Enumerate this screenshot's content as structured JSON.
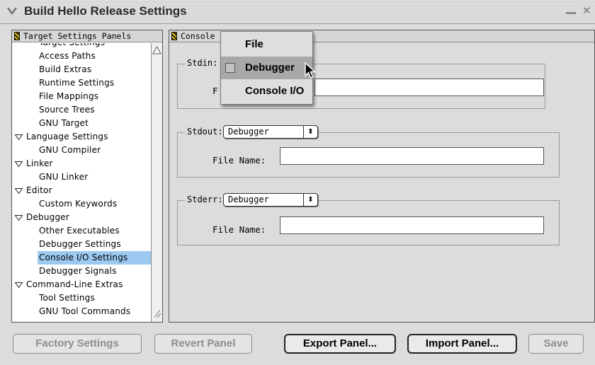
{
  "window": {
    "title": "Build Hello Release Settings",
    "collapse_icon": "chevron-down-icon",
    "minimize_icon": "minimize-icon",
    "close_glyph": "✕"
  },
  "left_panel": {
    "header": "Target Settings Panels",
    "items": [
      {
        "label": "Target Settings",
        "level": 1
      },
      {
        "label": "Access Paths",
        "level": 1
      },
      {
        "label": "Build Extras",
        "level": 1
      },
      {
        "label": "Runtime Settings",
        "level": 1
      },
      {
        "label": "File Mappings",
        "level": 1
      },
      {
        "label": "Source Trees",
        "level": 1
      },
      {
        "label": "GNU Target",
        "level": 1
      },
      {
        "label": "Language Settings",
        "level": 0,
        "expanded": true
      },
      {
        "label": "GNU Compiler",
        "level": 1
      },
      {
        "label": "Linker",
        "level": 0,
        "expanded": true
      },
      {
        "label": "GNU Linker",
        "level": 1
      },
      {
        "label": "Editor",
        "level": 0,
        "expanded": true
      },
      {
        "label": "Custom Keywords",
        "level": 1
      },
      {
        "label": "Debugger",
        "level": 0,
        "expanded": true
      },
      {
        "label": "Other Executables",
        "level": 1
      },
      {
        "label": "Debugger Settings",
        "level": 1
      },
      {
        "label": "Console I/O Settings",
        "level": 1,
        "selected": true
      },
      {
        "label": "Debugger Signals",
        "level": 1
      },
      {
        "label": "Command-Line Extras",
        "level": 0,
        "expanded": true
      },
      {
        "label": "Tool Settings",
        "level": 1
      },
      {
        "label": "GNU Tool Commands",
        "level": 1
      }
    ]
  },
  "right_panel": {
    "header": "Console I",
    "stdin": {
      "label": "Stdin:",
      "field_label": "F",
      "file_name": ""
    },
    "stdout": {
      "label": "Stdout:",
      "selected": "Debugger",
      "field_label": "File Name:",
      "file_name": ""
    },
    "stderr": {
      "label": "Stderr:",
      "selected": "Debugger",
      "field_label": "File Name:",
      "file_name": ""
    }
  },
  "popup_menu": {
    "items": [
      {
        "label": "File",
        "highlighted": false,
        "checked": false
      },
      {
        "label": "Debugger",
        "highlighted": true,
        "checked": true
      },
      {
        "label": "Console I/O",
        "highlighted": false,
        "checked": false
      }
    ]
  },
  "buttons": {
    "factory_settings": "Factory Settings",
    "revert_panel": "Revert Panel",
    "export_panel": "Export Panel...",
    "import_panel": "Import Panel...",
    "save": "Save"
  },
  "colors": {
    "selection": "#9cc9f0",
    "menu_highlight": "#a8a8a8",
    "window_bg": "#dcdcdc"
  }
}
